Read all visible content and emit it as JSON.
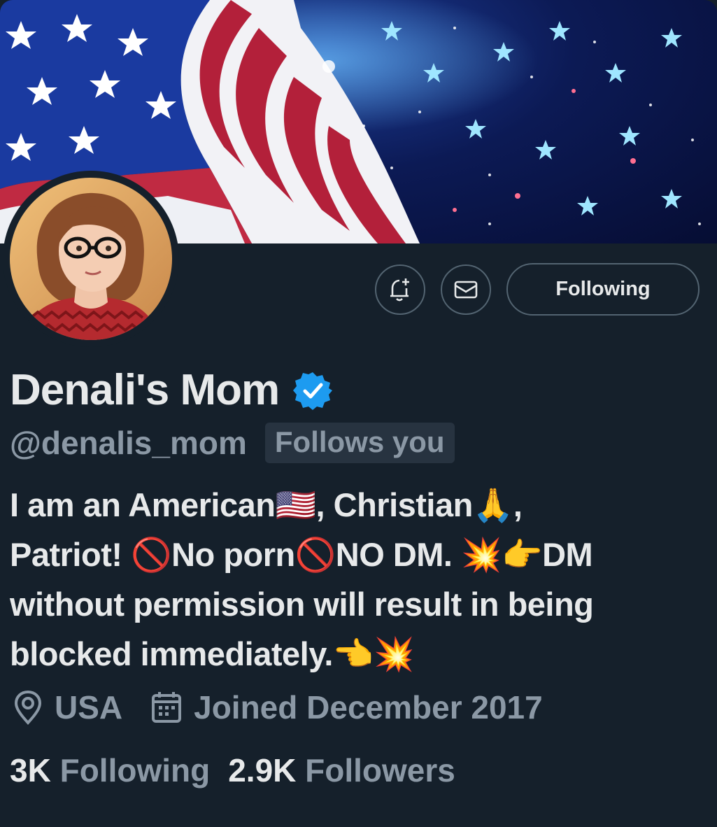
{
  "profile": {
    "name": "Denali's Mom",
    "handle": "@denalis_mom",
    "follows_you": "Follows you",
    "bio": {
      "line1_a": "I am an American",
      "line1_b": ", Christian",
      "line1_c": ",",
      "line2_a": "Patriot! ",
      "line2_b": "No porn",
      "line2_c": "NO DM. ",
      "line2_d": "DM",
      "line3": "without permission will result in being",
      "line4": "blocked immediately."
    },
    "location": "USA",
    "joined": "Joined December 2017",
    "following_count": "3K",
    "following_label": "Following",
    "followers_count": "2.9K",
    "followers_label": "Followers",
    "verified": true
  },
  "actions": {
    "notify_icon": "bell-plus-icon",
    "message_icon": "envelope-icon",
    "follow_button_label": "Following"
  },
  "colors": {
    "background": "#15202b",
    "text_primary": "#e7e9ea",
    "text_secondary": "#8b98a5",
    "border": "#536471",
    "verified_blue": "#1d9bf0"
  }
}
